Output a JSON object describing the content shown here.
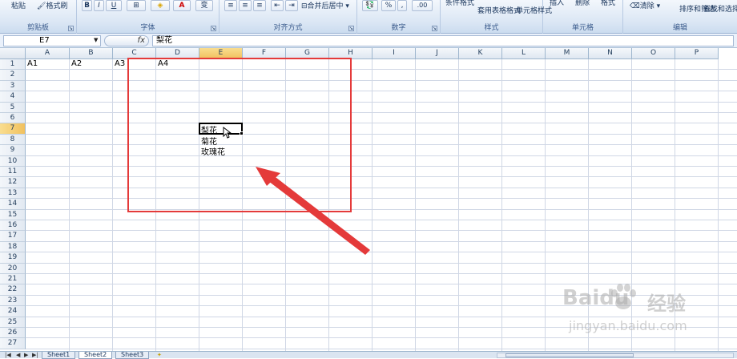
{
  "ribbon": {
    "clipboard": {
      "paste": "粘贴",
      "format_painter": "格式刷",
      "label": "剪贴板"
    },
    "font": {
      "bold": "B",
      "italic": "I",
      "underline": "U",
      "color_a": "A",
      "wen": "变",
      "label": "字体"
    },
    "alignment": {
      "merge_center": "合并后居中",
      "label": "对齐方式"
    },
    "number": {
      "percent": "%",
      "comma": ",",
      "decimals": ".00",
      "label": "数字"
    },
    "styles": {
      "cond_format": "条件格式",
      "table_format": "套用表格格式",
      "cell_style": "单元格样式",
      "label": "样式"
    },
    "cells": {
      "insert": "插入",
      "delete": "删除",
      "format": "格式",
      "label": "单元格"
    },
    "editing": {
      "clear": "清除",
      "sort_filter": "排序和筛选",
      "find_select": "查找和选择",
      "label": "编辑"
    }
  },
  "formula_bar": {
    "name_box": "E7",
    "fx": "fx",
    "formula": "梨花"
  },
  "columns": [
    "A",
    "B",
    "C",
    "D",
    "E",
    "F",
    "G",
    "H",
    "I",
    "J",
    "K",
    "L",
    "M",
    "N",
    "O",
    "P"
  ],
  "selected_column": "E",
  "rows": [
    "1",
    "2",
    "3",
    "4",
    "5",
    "6",
    "7",
    "8",
    "9",
    "10",
    "11",
    "12",
    "13",
    "14",
    "15",
    "16",
    "17",
    "18",
    "19",
    "20",
    "21",
    "22",
    "23",
    "24",
    "25",
    "26",
    "27"
  ],
  "selected_row": "7",
  "cells": {
    "A1": "A1",
    "B1": "A2",
    "C1": "A3",
    "D1": "A4",
    "E7": "梨花",
    "E8": "菊花",
    "E9": "玫瑰花"
  },
  "sheets": [
    "Sheet1",
    "Sheet2",
    "Sheet3"
  ],
  "active_sheet": "Sheet2",
  "watermark": {
    "brand": "Baidu",
    "cn": "经验",
    "url": "jingyan.baidu.com"
  },
  "colors": {
    "highlight_box": "#e43a3a",
    "header_selected": "#f1c15f"
  }
}
